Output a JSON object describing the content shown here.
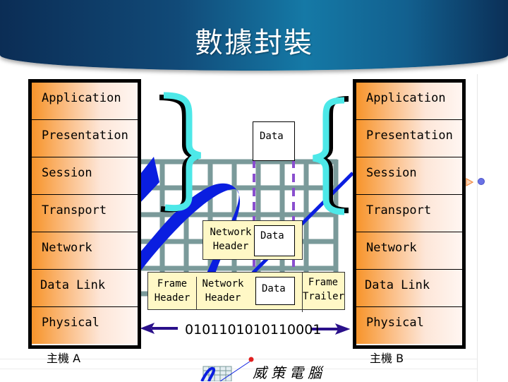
{
  "title": "數據封裝",
  "host_a": {
    "label": "主機 A",
    "layers": [
      "Application",
      "Presentation",
      "Session",
      "Transport",
      "Network",
      "Data Link",
      "Physical"
    ]
  },
  "host_b": {
    "label": "主機 B",
    "layers": [
      "Application",
      "Presentation",
      "Session",
      "Transport",
      "Network",
      "Data Link",
      "Physical"
    ]
  },
  "encapsulation": {
    "app_data": "Data",
    "network_packet": {
      "header": "Network Header",
      "data": "Data"
    },
    "frame": {
      "header": "Frame Header",
      "network_header": "Network Header",
      "data": "Data",
      "trailer": "Frame Trailer"
    },
    "bits": "0101101010110001"
  },
  "footer": {
    "brand": "威策電腦"
  },
  "colors": {
    "header_dark": "#0b2d55",
    "header_light": "#1579a6",
    "layer_orange": "#f7942a",
    "grid": "#7a9a9a",
    "brace": "#4de8e8",
    "swoosh": "#0a1ee0",
    "dash": "#8a4fcf",
    "arrow": "#2a108a",
    "pdu_fill": "#fff8c6"
  }
}
